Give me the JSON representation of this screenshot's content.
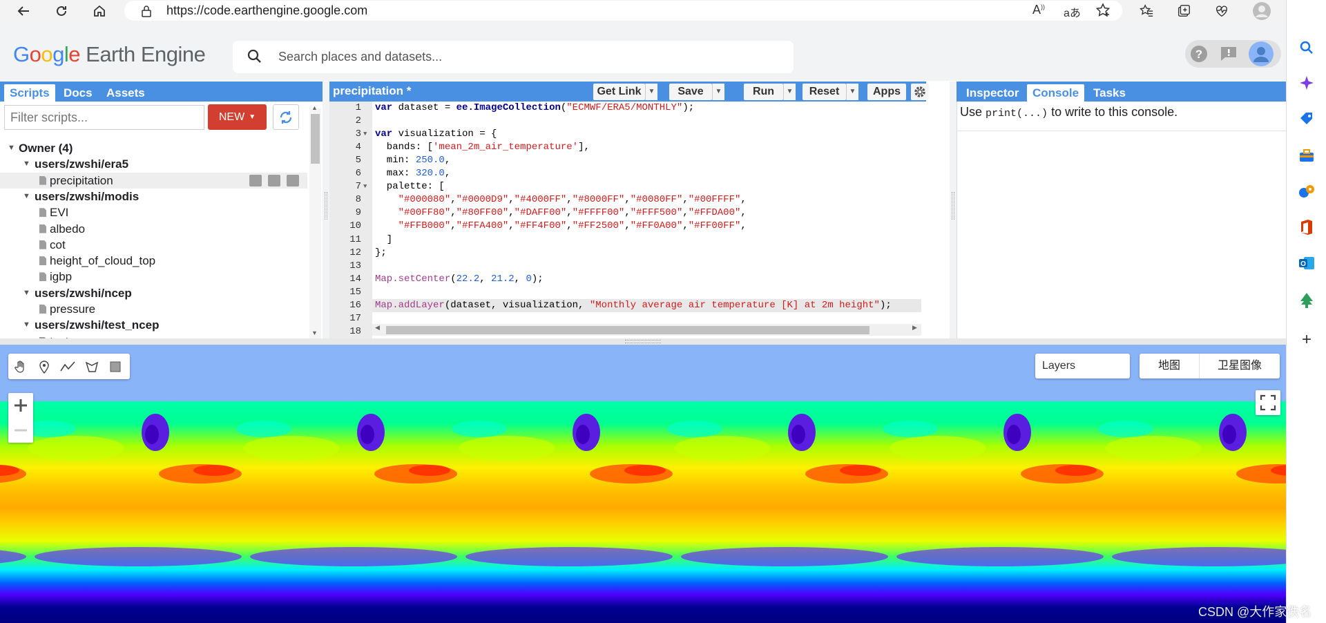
{
  "browser": {
    "url": "https://code.earthengine.google.com",
    "icons": [
      "back-icon",
      "refresh-icon",
      "home-icon",
      "lock-icon",
      "read-aloud-icon",
      "translate-icon",
      "add-favorite-icon",
      "favorites-icon",
      "collections-icon",
      "browser-essentials-icon",
      "profile-icon",
      "more-icon"
    ]
  },
  "browser_sidebar": {
    "icons": [
      "search-icon",
      "copilot-icon",
      "shopping-icon",
      "tools-icon",
      "games-icon",
      "office-icon",
      "outlook-icon",
      "tree-icon",
      "add-icon"
    ]
  },
  "header": {
    "logo_google": [
      "G",
      "o",
      "o",
      "g",
      "l",
      "e"
    ],
    "logo_google_colors": [
      "#4285f4",
      "#ea4335",
      "#fbbc05",
      "#4285f4",
      "#34a853",
      "#ea4335"
    ],
    "logo_product": "Earth Engine",
    "search_placeholder": "Search places and datasets...",
    "icons": [
      "help-icon",
      "feedback-icon",
      "account-icon"
    ]
  },
  "left_panel": {
    "tabs": [
      {
        "label": "Scripts",
        "active": true
      },
      {
        "label": "Docs",
        "active": false
      },
      {
        "label": "Assets",
        "active": false
      }
    ],
    "filter_placeholder": "Filter scripts...",
    "new_label": "NEW",
    "tree": [
      {
        "label": "Owner (4)",
        "level": 0,
        "type": "group"
      },
      {
        "label": "users/zwshi/era5",
        "level": 1,
        "type": "repo"
      },
      {
        "label": "precipitation",
        "level": 2,
        "type": "file",
        "selected": true
      },
      {
        "label": "users/zwshi/modis",
        "level": 1,
        "type": "repo"
      },
      {
        "label": "EVI",
        "level": 2,
        "type": "file"
      },
      {
        "label": "albedo",
        "level": 2,
        "type": "file"
      },
      {
        "label": "cot",
        "level": 2,
        "type": "file"
      },
      {
        "label": "height_of_cloud_top",
        "level": 2,
        "type": "file"
      },
      {
        "label": "igbp",
        "level": 2,
        "type": "file"
      },
      {
        "label": "users/zwshi/ncep",
        "level": 1,
        "type": "repo"
      },
      {
        "label": "pressure",
        "level": 2,
        "type": "file"
      },
      {
        "label": "users/zwshi/test_ncep",
        "level": 1,
        "type": "repo"
      },
      {
        "label": "test_ncep",
        "level": 2,
        "type": "file"
      }
    ]
  },
  "editor": {
    "title": "precipitation *",
    "buttons": {
      "get_link": "Get Link",
      "save": "Save",
      "run": "Run",
      "reset": "Reset",
      "apps": "Apps"
    },
    "lines": [
      "var dataset = ee.ImageCollection(\"ECMWF/ERA5/MONTHLY\");",
      "",
      "var visualization = {",
      "  bands: ['mean_2m_air_temperature'],",
      "  min: 250.0,",
      "  max: 320.0,",
      "  palette: [",
      "    \"#000080\",\"#0000D9\",\"#4000FF\",\"#8000FF\",\"#0080FF\",\"#00FFFF\",",
      "    \"#00FF80\",\"#80FF00\",\"#DAFF00\",\"#FFFF00\",\"#FFF500\",\"#FFDA00\",",
      "    \"#FFB000\",\"#FFA400\",\"#FF4F00\",\"#FF2500\",\"#FF0A00\",\"#FF00FF\",",
      "  ]",
      "};",
      "",
      "Map.setCenter(22.2, 21.2, 0);",
      "",
      "Map.addLayer(dataset, visualization, \"Monthly average air temperature [K] at 2m height\");",
      "",
      ""
    ],
    "line_numbers": [
      "1",
      "2",
      "3",
      "4",
      "5",
      "6",
      "7",
      "8",
      "9",
      "10",
      "11",
      "12",
      "13",
      "14",
      "15",
      "16",
      "17",
      "18"
    ],
    "active_line": 16
  },
  "right_panel": {
    "tabs": [
      {
        "label": "Inspector",
        "active": false
      },
      {
        "label": "Console",
        "active": true
      },
      {
        "label": "Tasks",
        "active": false
      }
    ],
    "console_prefix": "Use",
    "console_code": "print(...)",
    "console_suffix": "to write to this console."
  },
  "map": {
    "layers_label": "Layers",
    "map_type_map": "地图",
    "map_type_satellite": "卫星图像",
    "tools": [
      "hand-icon",
      "marker-icon",
      "line-icon",
      "polygon-icon",
      "rectangle-icon"
    ],
    "palette": [
      "#000080",
      "#0000D9",
      "#4000FF",
      "#8000FF",
      "#0080FF",
      "#00FFFF",
      "#00FF80",
      "#80FF00",
      "#DAFF00",
      "#FFFF00",
      "#FFF500",
      "#FFDA00",
      "#FFB000",
      "#FFA400",
      "#FF4F00",
      "#FF2500",
      "#FF0A00",
      "#FF00FF"
    ]
  },
  "watermark": "CSDN @大作家佚名"
}
